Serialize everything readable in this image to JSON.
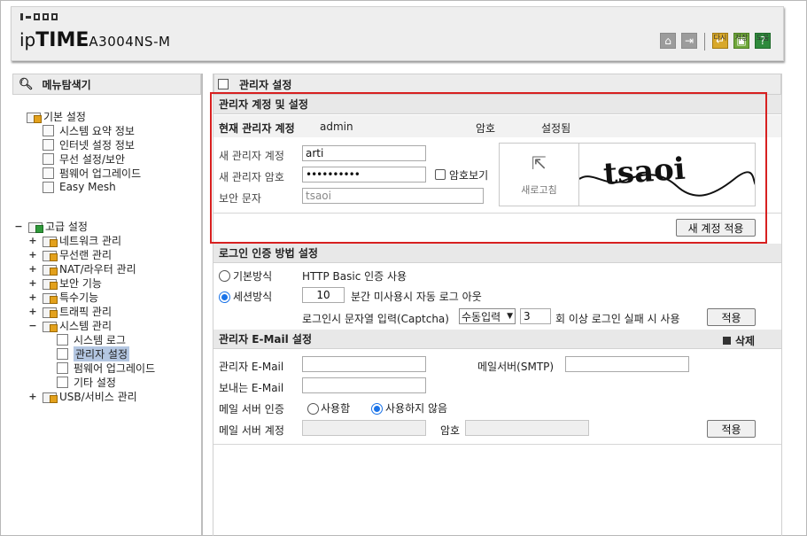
{
  "header": {
    "brand_prefix": "ip",
    "brand_bold": "TIME",
    "model": "A3004NS-M",
    "toolbar": {
      "home_icon": "home-icon",
      "logout_icon": "logout-icon",
      "restart_label": "다시",
      "save_label": "저장",
      "help_label": "도움"
    }
  },
  "sidebar": {
    "title": "메뉴탐색기",
    "basic": {
      "label": "기본 설정",
      "items": [
        "시스템 요약 정보",
        "인터넷 설정 정보",
        "무선 설정/보안",
        "펌웨어 업그레이드",
        "Easy Mesh"
      ]
    },
    "advanced": {
      "expander": "−",
      "label": "고급 설정",
      "items": [
        {
          "exp": "+",
          "label": "네트워크 관리"
        },
        {
          "exp": "+",
          "label": "무선랜 관리"
        },
        {
          "exp": "+",
          "label": "NAT/라우터 관리"
        },
        {
          "exp": "+",
          "label": "보안 기능"
        },
        {
          "exp": "+",
          "label": "특수기능"
        },
        {
          "exp": "+",
          "label": "트래픽 관리"
        },
        {
          "exp": "−",
          "label": "시스템 관리"
        }
      ],
      "system_items": [
        "시스템 로그",
        "관리자 설정",
        "펌웨어 업그레이드",
        "기타 설정"
      ],
      "usb": {
        "exp": "+",
        "label": "USB/서비스 관리"
      }
    }
  },
  "main": {
    "title": "관리자 설정",
    "account": {
      "heading": "관리자 계정 및 설정",
      "current_label": "현재 관리자 계정",
      "current_value": "admin",
      "password_label": "암호",
      "password_value": "설정됨",
      "new_id_label": "새 관리자 계정",
      "new_id_value": "arti",
      "new_pw_label": "새 관리자 암호",
      "new_pw_value": "••••••••••",
      "show_pw_label": "암호보기",
      "captcha_label": "보안 문자",
      "captcha_value": "tsaoi",
      "captcha_text": "tsaoi",
      "refresh_label": "새로고침",
      "apply_label": "새 계정 적용"
    },
    "login": {
      "heading": "로그인 인증 방법 설정",
      "basic_label": "기본방식",
      "basic_desc": "HTTP Basic 인증 사용",
      "session_label": "세션방식",
      "session_minutes": "10",
      "session_desc": "분간 미사용시 자동 로그 아웃",
      "captcha_label": "로그인시 문자열 입력(Captcha)",
      "captcha_mode": "수동입력",
      "fail_count": "3",
      "fail_desc": "회 이상 로그인 실패 시 사용",
      "apply_label": "적용"
    },
    "email": {
      "heading": "관리자 E-Mail 설정",
      "delete_label": "삭제",
      "admin_email_label": "관리자 E-Mail",
      "admin_email_value": "",
      "smtp_label": "메일서버(SMTP)",
      "smtp_value": "",
      "sender_label": "보내는 E-Mail",
      "sender_value": "",
      "auth_label": "메일 서버 인증",
      "auth_on": "사용함",
      "auth_off": "사용하지 않음",
      "account_label": "메일 서버 계정",
      "account_value": "",
      "pw_label": "암호",
      "pw_value": "",
      "apply_label": "적용"
    }
  }
}
